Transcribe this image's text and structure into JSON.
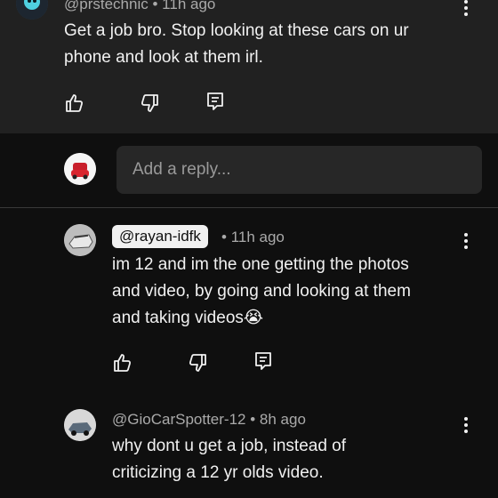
{
  "top_comment": {
    "handle": "@prstechnic",
    "time": "11h ago",
    "text_line1": "Get a job bro. Stop looking at these cars on ur",
    "text_line2": "phone and look at them irl."
  },
  "reply_input": {
    "placeholder": "Add a reply..."
  },
  "replies": [
    {
      "handle": "@rayan-idfk",
      "time": "11h ago",
      "line1": "im 12 and im the one getting the photos",
      "line2": "and video, by going and looking at them",
      "line3": "and taking videos",
      "emoji": "😭"
    },
    {
      "handle": "@GioCarSpotter-12",
      "time": "8h ago",
      "line1": "why dont u get a job, instead of",
      "line2": "criticizing a 12 yr olds video."
    }
  ],
  "separator": "•",
  "icons": [
    "like-icon",
    "dislike-icon",
    "reply-icon",
    "more-options-icon"
  ],
  "colors": {
    "background": "#0f0f0f",
    "highlight_bg": "#212121",
    "input_bg": "#272727",
    "text": "#f1f1f1",
    "meta": "#aaaaaa"
  }
}
